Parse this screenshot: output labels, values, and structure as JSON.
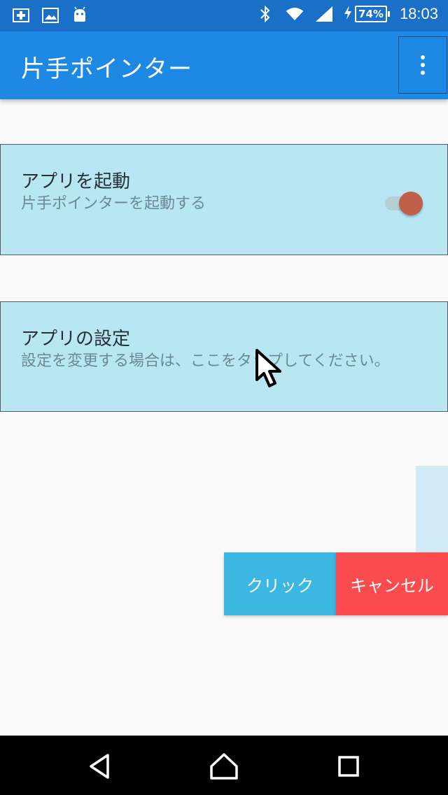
{
  "status_bar": {
    "icons_left": [
      "plus-box-icon",
      "image-icon",
      "android-icon"
    ],
    "icons_right": [
      "bluetooth-icon",
      "wifi-icon",
      "signal-icon",
      "charging-icon"
    ],
    "battery": "74%",
    "time": "18:03"
  },
  "app_bar": {
    "title": "片手ポインター",
    "menu_icon": "overflow-menu-icon"
  },
  "launch_card": {
    "title": "アプリを起動",
    "subtitle": "片手ポインターを起動する",
    "toggle_on": true
  },
  "settings_card": {
    "title": "アプリの設定",
    "subtitle": "設定を変更する場合は、ここをタップしてください。"
  },
  "actions": {
    "click_label": "クリック",
    "cancel_label": "キャンセル"
  },
  "nav_bar": {
    "buttons": [
      "back-icon",
      "home-icon",
      "recents-icon"
    ]
  },
  "colors": {
    "status_bar": "#1a6fc7",
    "app_bar": "#1e88e5",
    "card": "#b9e6f3",
    "toggle_thumb": "#c0604a",
    "click_button": "#3cb6e3",
    "cancel_button": "#fa4c4f"
  }
}
